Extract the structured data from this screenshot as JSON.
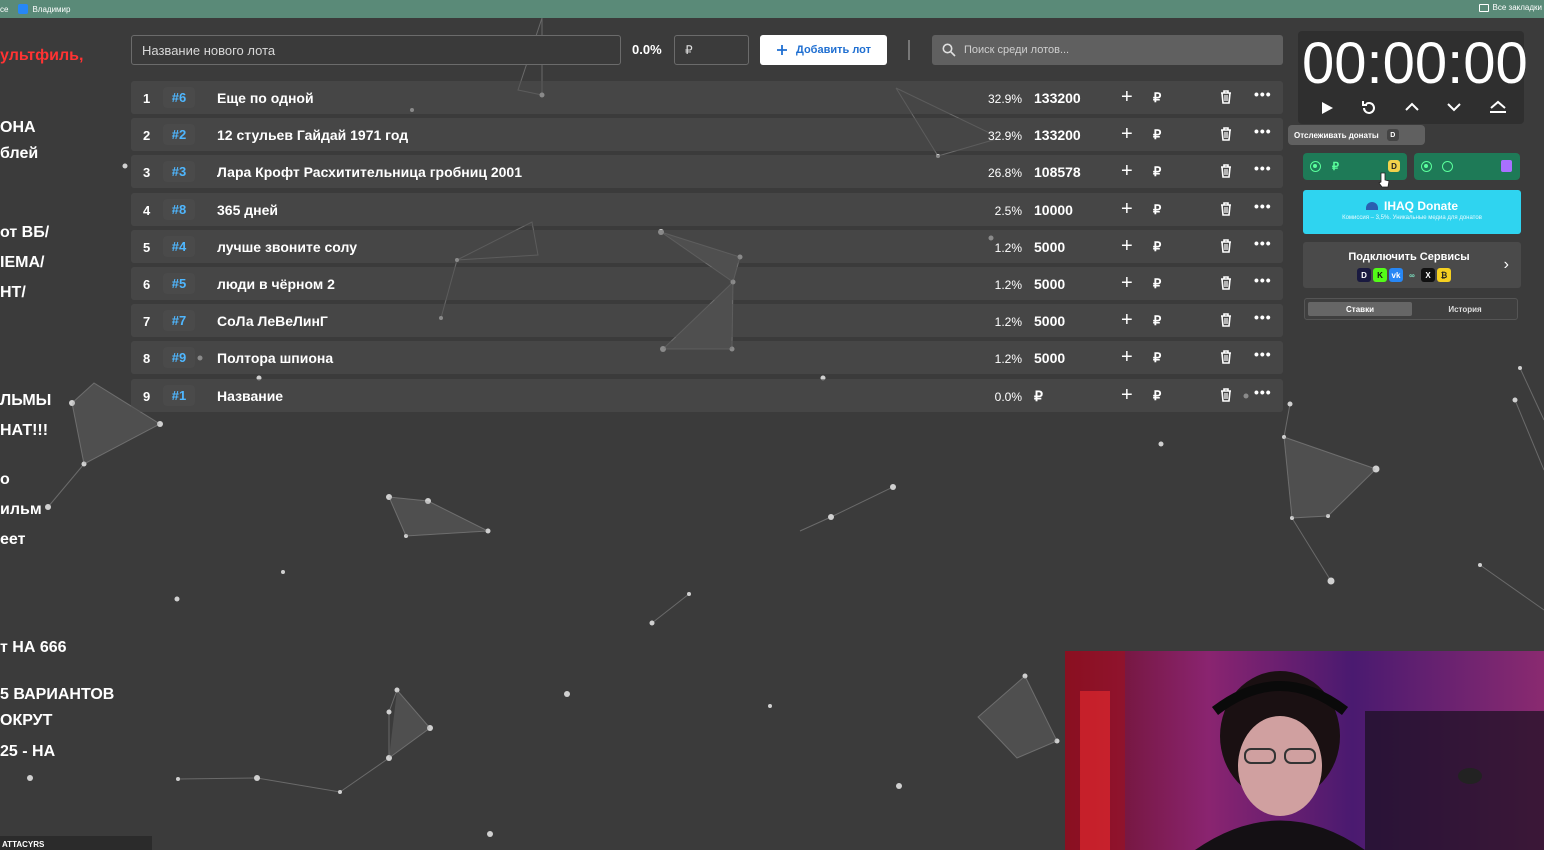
{
  "browser": {
    "bookmark_1": "се",
    "bookmark_2": "Владимир",
    "all_bookmarks": "Все закладки"
  },
  "overlay_left": {
    "lines": [
      {
        "text": "ультфиль,",
        "red": true
      },
      {
        "text": "ОНА",
        "red": false
      },
      {
        "text": "блей",
        "red": false
      },
      {
        "text": "от ВБ/",
        "red": false
      },
      {
        "text": "ІЕМА/",
        "red": false
      },
      {
        "text": "НТ/",
        "red": false
      },
      {
        "text": "ЛЬМЫ",
        "red": false
      },
      {
        "text": "НАТ!!!",
        "red": false
      },
      {
        "text": "о",
        "red": false
      },
      {
        "text": "ильм",
        "red": false
      },
      {
        "text": "еет",
        "red": false
      },
      {
        "text": "т НА 666",
        "red": false
      },
      {
        "text": "5 ВАРИАНТОВ",
        "red": false
      },
      {
        "text": "ОКРУТ",
        "red": false
      },
      {
        "text": "25 - НА",
        "red": false
      }
    ],
    "bottom_text": "ATTACYRS"
  },
  "toolbar": {
    "name_placeholder": "Название нового лота",
    "percent": "0.0%",
    "currency_placeholder": "₽",
    "add_label": "Добавить лот",
    "search_placeholder": "Поиск среди лотов..."
  },
  "lots": [
    {
      "num": "1",
      "tag": "#6",
      "title": "Еще по одной",
      "pct": "32.9%",
      "amount": "133200"
    },
    {
      "num": "2",
      "tag": "#2",
      "title": "12 стульев Гайдай 1971 год",
      "pct": "32.9%",
      "amount": "133200"
    },
    {
      "num": "3",
      "tag": "#3",
      "title": "Лара Крофт Расхитительница гробниц 2001",
      "pct": "26.8%",
      "amount": "108578"
    },
    {
      "num": "4",
      "tag": "#8",
      "title": "365 дней",
      "pct": "2.5%",
      "amount": "10000"
    },
    {
      "num": "5",
      "tag": "#4",
      "title": "лучше  звоните солу",
      "pct": "1.2%",
      "amount": "5000"
    },
    {
      "num": "6",
      "tag": "#5",
      "title": "люди в чёрном 2",
      "pct": "1.2%",
      "amount": "5000"
    },
    {
      "num": "7",
      "tag": "#7",
      "title": "СоЛа ЛеВеЛинГ",
      "pct": "1.2%",
      "amount": "5000"
    },
    {
      "num": "8",
      "tag": "#9",
      "title": "Полтора шпиона",
      "pct": "1.2%",
      "amount": "5000"
    },
    {
      "num": "9",
      "tag": "#1",
      "title": "Название",
      "pct": "0.0%",
      "amount": "₽"
    }
  ],
  "row_labels": {
    "plus": "+",
    "rub": "₽",
    "more": "•••"
  },
  "timer": {
    "display": "00:00:00",
    "tooltip": "Отслеживать донаты",
    "tooltip_key": "D"
  },
  "services": {
    "rub": "₽",
    "donate_title": "IHAQ Donate",
    "donate_sub": "Комиссия – 3,5%. Уникальные медиа для донатов",
    "connect_title": "Подключить Сервисы",
    "tab_bets": "Ставки",
    "tab_history": "История"
  },
  "colors": {
    "tag_blue": "#4fb7ff",
    "donate_cyan": "#2fd4f0",
    "service_green": "#1e7a57",
    "accent_red": "#ff3333"
  }
}
